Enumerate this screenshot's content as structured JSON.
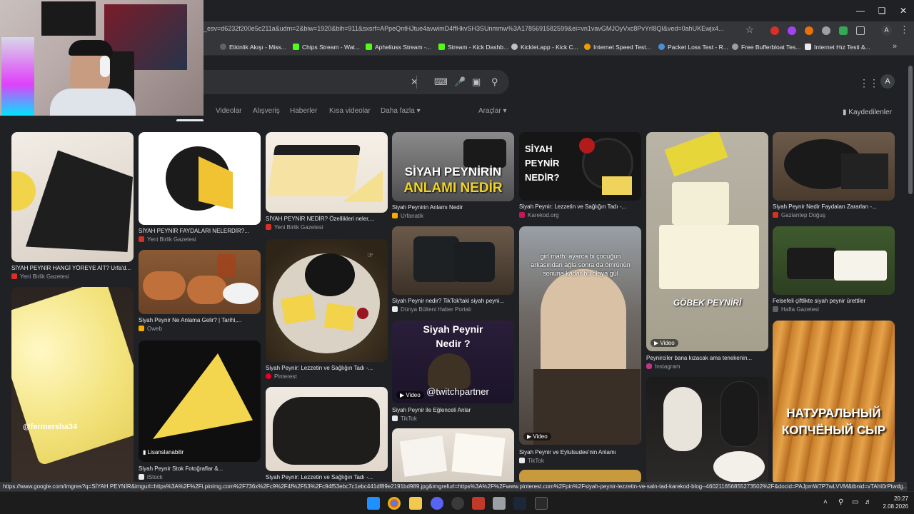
{
  "browser": {
    "url": "_esv=d6232f200e5c211a&udm=2&biw=1920&bih=911&sxsrf=APpeQntHJtue4avwimD4ffHkvSH3SUnmmw%3A1785691582599&ei=vn1vavGMJOyVxc8PvYrI8QI&ved=0ahUKEwjx4...",
    "profile_letter": "A",
    "bookmarks": [
      "Etkinlik Akışı - Miss...",
      "Chips Stream - Wat...",
      "Apheliuss Stream -...",
      "Stream - Kick Dashb...",
      "Kicklet.app - Kick C...",
      "Internet Speed Test...",
      "Packet Loss Test - R...",
      "Free Bufferbloat Tes...",
      "Internet Hız Testi &..."
    ]
  },
  "google": {
    "avatar_letter": "A",
    "tabs": [
      "Videolar",
      "Alışveriş",
      "Haberler",
      "Kısa videolar",
      "Daha fazla"
    ],
    "tools": "Araçlar",
    "saved": "Kaydedilenler"
  },
  "results": [
    {
      "caption": "SİYAH PEYNİR HANGİ YÖREYE AİT? Urfa'd...",
      "source": "Yeni Birlik Gazetesi"
    },
    {
      "caption": "SİYAH PEYNİR FAYDALARI NELERDİR?...",
      "source": "Yeni Birlik Gazetesi"
    },
    {
      "caption": "SİYAH PEYNİR NEDİR? Özellikleri neler,...",
      "source": "Yeni Birlik Gazetesi"
    },
    {
      "caption": "Siyah Peynirin Anlamı Nedir",
      "source": "Urfanatik",
      "overlay_top": "SİYAH PEYNİRİN",
      "overlay_bottom": "ANLAMI NEDİR"
    },
    {
      "caption": "Siyah Peynir: Lezzetin ve Sağlığın Tadı -...",
      "source": "Karekod.org",
      "overlay": "SİYAH PEYNİR NEDİR?"
    },
    {
      "caption": "Peynirciler bana kızacak ama tenekenin...",
      "source": "Instagram",
      "overlay": "GÖBEK PEYNİRİ",
      "badge": "Video"
    },
    {
      "caption": "Siyah Peynir Nedir Faydaları Zararları -...",
      "source": "Gaziantep Doğuş"
    },
    {
      "caption": "Siyah Peynir Ne Anlama Gelir? | Tarihi,...",
      "source": "Oweb"
    },
    {
      "caption": "Siyah Peynir: Lezzetin ve Sağlığın Tadı -...",
      "source": "Pinterest"
    },
    {
      "caption": "Siyah Peynir nedir? TikTok'taki siyah peyni...",
      "source": "Dünya Bülteni Haber Portalı"
    },
    {
      "caption": "Siyah Peynir ve Eylulsudee'nin Anlamı",
      "source": "TikTok",
      "overlay": "girl math: ayarca bi çocuğun arkasından ağla sonra da ömrünün sonuna kadar bu olaya gül",
      "badge": "Video"
    },
    {
      "caption": "Felsefeli çiftlikte siyah peynir ürettiler",
      "source": "Hafta Gazetesi"
    },
    {
      "caption": "",
      "source": "",
      "overlay": "@fermersha34"
    },
    {
      "caption": "Siyah Peynir Stok Fotoğraflar &...",
      "source": "iStock",
      "badge": "Lisanslanabilir"
    },
    {
      "caption": "Siyah Peynir ile Eğlenceli Anlar",
      "source": "TikTok",
      "overlay_top": "Siyah Peynir",
      "overlay_bottom": "Nedir ?",
      "overlay_extra": "@twitchpartner",
      "badge": "Video"
    },
    {
      "caption": "Siyah Peynir: Lezzetin ve Sağlığın Tadı -...",
      "source": ""
    },
    {
      "caption": "",
      "source": "",
      "overlay_top": "НАТУРАЛЬНЫЙ",
      "overlay_bottom": "КОПЧЁНЫЙ СЫР"
    }
  ],
  "status_url": "https://www.google.com/imgres?q=SİYAH PEYNİR&imgurl=https%3A%2F%2Fi.pinimg.com%2F736x%2Fc9%2F4f%2F53%2Fc94f53ebc7c1ebc441df89e2191bd989.jpg&imgrefurl=https%3A%2F%2Fwww.pinterest.com%2Fpin%2Fsiyah-peynir-lezzetin-ve-saln-tad-karekod-blog--460211656855273502%2F&docid=PAJpmW7P7wLVVM&tbnid=vTAhI0rPtwdg...",
  "taskbar": {
    "time": "20:27",
    "date": "2.08.2026"
  },
  "colors": {
    "page_bg": "#202124",
    "searchbox_bg": "#303134",
    "chrome_bg": "#35363a",
    "caption_text": "#e8eaed",
    "source_text": "#9aa0a6"
  }
}
